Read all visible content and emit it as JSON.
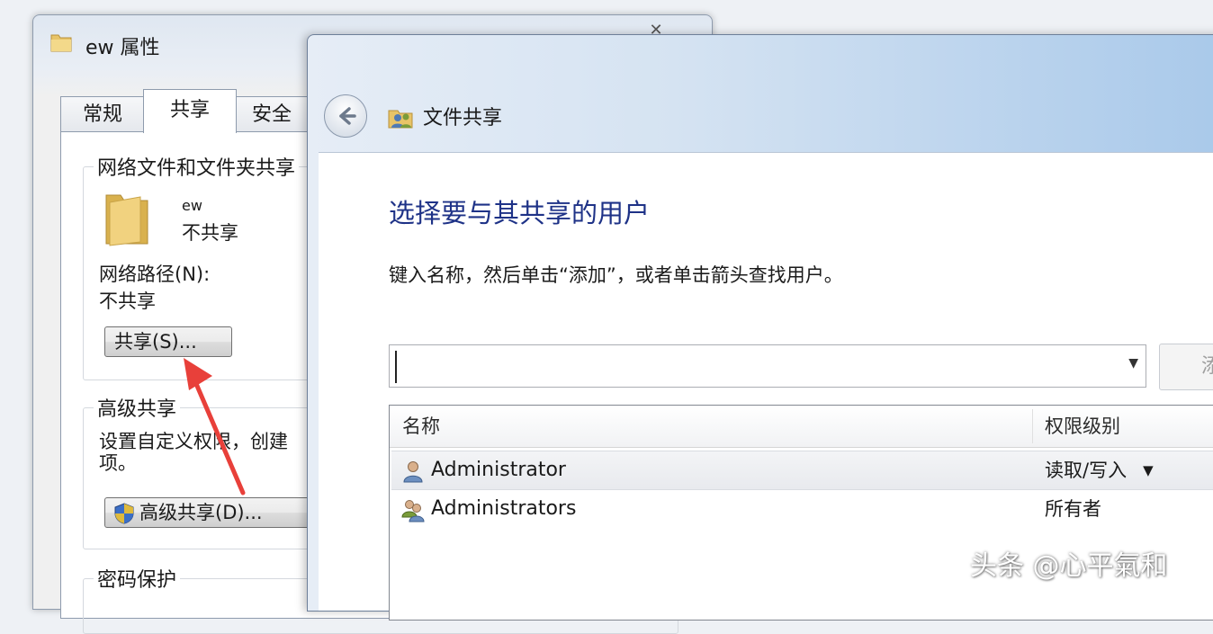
{
  "properties_window": {
    "title": "ew 属性",
    "tabs": [
      {
        "label": "常规"
      },
      {
        "label": "共享"
      },
      {
        "label": "安全"
      }
    ],
    "network_sharing": {
      "group_title": "网络文件和文件夹共享",
      "folder_name": "ew",
      "folder_status": "不共享",
      "network_path_label": "网络路径(N):",
      "network_path_value": "不共享",
      "share_button": "共享(S)..."
    },
    "advanced_sharing": {
      "group_title": "高级共享",
      "description_line1": "设置自定义权限，创建",
      "description_line2": "项。",
      "button": "高级共享(D)..."
    },
    "password_protection": {
      "group_title": "密码保护"
    }
  },
  "file_sharing_window": {
    "title": "文件共享",
    "heading": "选择要与其共享的用户",
    "instruction": "键入名称，然后单击“添加”，或者单击箭头查找用户。",
    "name_input": {
      "value": "",
      "placeholder": ""
    },
    "add_button": "添",
    "list": {
      "columns": [
        "名称",
        "权限级别"
      ],
      "rows": [
        {
          "name": "Administrator",
          "permission": "读取/写入",
          "icon": "user-icon",
          "selected": true
        },
        {
          "name": "Administrators",
          "permission": "所有者",
          "icon": "group-icon",
          "selected": false
        }
      ]
    }
  },
  "watermark": "头条 @心平氣和",
  "colors": {
    "heading_blue": "#1e3287",
    "annotation_red": "#e8403a",
    "title_gradient_end": "#a9c9ea"
  }
}
